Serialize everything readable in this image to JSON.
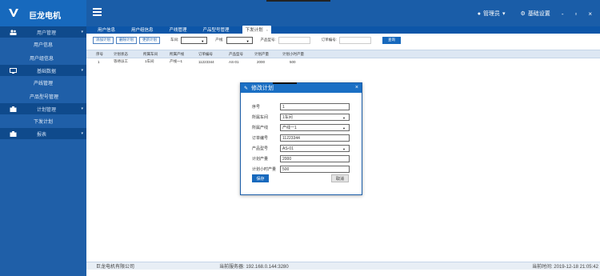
{
  "app": {
    "title": "巨龙电机"
  },
  "topbar": {
    "user_label": "管理员",
    "settings_label": "基础设置",
    "minimize_glyph": "-",
    "restore_glyph": "▫",
    "close_glyph": "×"
  },
  "sidebar": {
    "groups": [
      {
        "label": "用户管理",
        "items": [
          "用户信息",
          "用户组信息"
        ]
      },
      {
        "label": "基础数据",
        "items": [
          "产线管理",
          "产品型号管理"
        ]
      },
      {
        "label": "计划管理",
        "items": [
          "下发计划"
        ]
      },
      {
        "label": "报表",
        "items": []
      }
    ]
  },
  "tabs": [
    "用户信息",
    "用户组信息",
    "产线管理",
    "产品型号管理",
    "下发计划"
  ],
  "active_tab_index": 4,
  "toolbar": {
    "add_label": "添加计划",
    "delete_label": "删除计划",
    "update_label": "更新计划",
    "workshop_label": "车间:",
    "line_label": "产线:",
    "model_label": "产品型号:",
    "order_label": "订单编号:",
    "search_label": "查询"
  },
  "grid": {
    "headers": [
      "序号",
      "计划状态",
      "所属车间",
      "所属产线",
      "订单编号",
      "产品型号",
      "计划产量",
      "计划小时产量"
    ],
    "rows": [
      [
        "1",
        "等待派工",
        "1车间",
        "产线一1",
        "11223344",
        "AS-01",
        "2000",
        "500"
      ]
    ]
  },
  "dialog": {
    "title": "修改计划",
    "close_glyph": "×",
    "fields": [
      {
        "label": "序号",
        "value": "1",
        "type": "input"
      },
      {
        "label": "所属车间",
        "value": "1车间",
        "type": "select"
      },
      {
        "label": "所属产线",
        "value": "产线一1",
        "type": "select"
      },
      {
        "label": "订单编号",
        "value": "11223344",
        "type": "input"
      },
      {
        "label": "产品型号",
        "value": "AS-01",
        "type": "select"
      },
      {
        "label": "计划产量",
        "value": "2000",
        "type": "input"
      },
      {
        "label": "计划小时产量",
        "value": "500",
        "type": "input"
      }
    ],
    "save_label": "保存",
    "cancel_label": "取消"
  },
  "statusbar": {
    "company": "巨龙电机有限公司",
    "server": "当前服务器: 192.168.0.144:3280",
    "time": "当前时间: 2019-12-18 21:05:42"
  },
  "colors": {
    "topbar": "#1a5da8",
    "sidebar": "#1f5fa8",
    "sidebar_group": "#0f4a8c",
    "accent": "#1769bd"
  }
}
